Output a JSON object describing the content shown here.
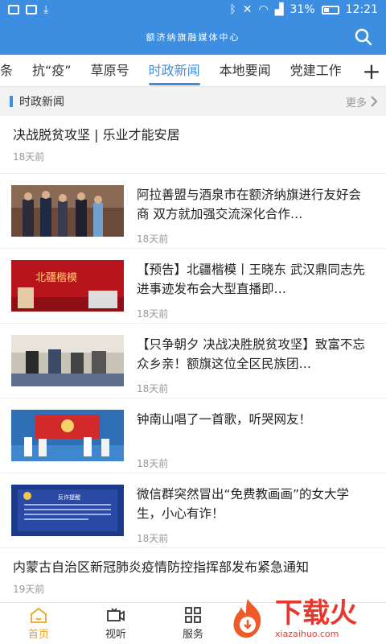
{
  "status": {
    "battery": "31%",
    "time": "12:21"
  },
  "appbar": {
    "title": "额济纳旗融媒体中心"
  },
  "tabs": [
    {
      "label": "条"
    },
    {
      "label": "抗“疫”"
    },
    {
      "label": "草原号"
    },
    {
      "label": "时政新闻",
      "active": true
    },
    {
      "label": "本地要闻"
    },
    {
      "label": "党建工作"
    }
  ],
  "section": {
    "title": "时政新闻",
    "more": "更多"
  },
  "news": [
    {
      "title": "决战脱贫攻坚 | 乐业才能安居",
      "date": "18天前"
    },
    {
      "title": "阿拉善盟与酒泉市在额济纳旗进行友好会商  双方就加强交流深化合作…",
      "date": "18天前"
    },
    {
      "title": "【预告】北疆楷模丨王晓东 武汉鼎同志先进事迹发布会大型直播即…",
      "date": "18天前"
    },
    {
      "title": "【只争朝夕 决战决胜脱贫攻坚】致富不忘众乡亲！额旗这位全区民族团…",
      "date": "18天前"
    },
    {
      "title": "钟南山唱了一首歌，听哭网友！",
      "date": "18天前"
    },
    {
      "title": "微信群突然冒出“免费教画画”的女大学生，小心有诈！",
      "date": "18天前"
    },
    {
      "title": "内蒙古自治区新冠肺炎疫情防控指挥部发布紧急通知",
      "date": "19天前"
    }
  ],
  "thumbs": {
    "poster_text": "北疆楷模",
    "notice_text": "反诈提醒"
  },
  "nav": [
    {
      "label": "首页"
    },
    {
      "label": "视听"
    },
    {
      "label": "服务"
    }
  ],
  "watermark": {
    "brand": "下载火",
    "url": "xiazaihuo.com"
  },
  "colors": {
    "primary": "#3d8ee0",
    "active_nav": "#f0a020",
    "watermark": "#e8382e"
  }
}
